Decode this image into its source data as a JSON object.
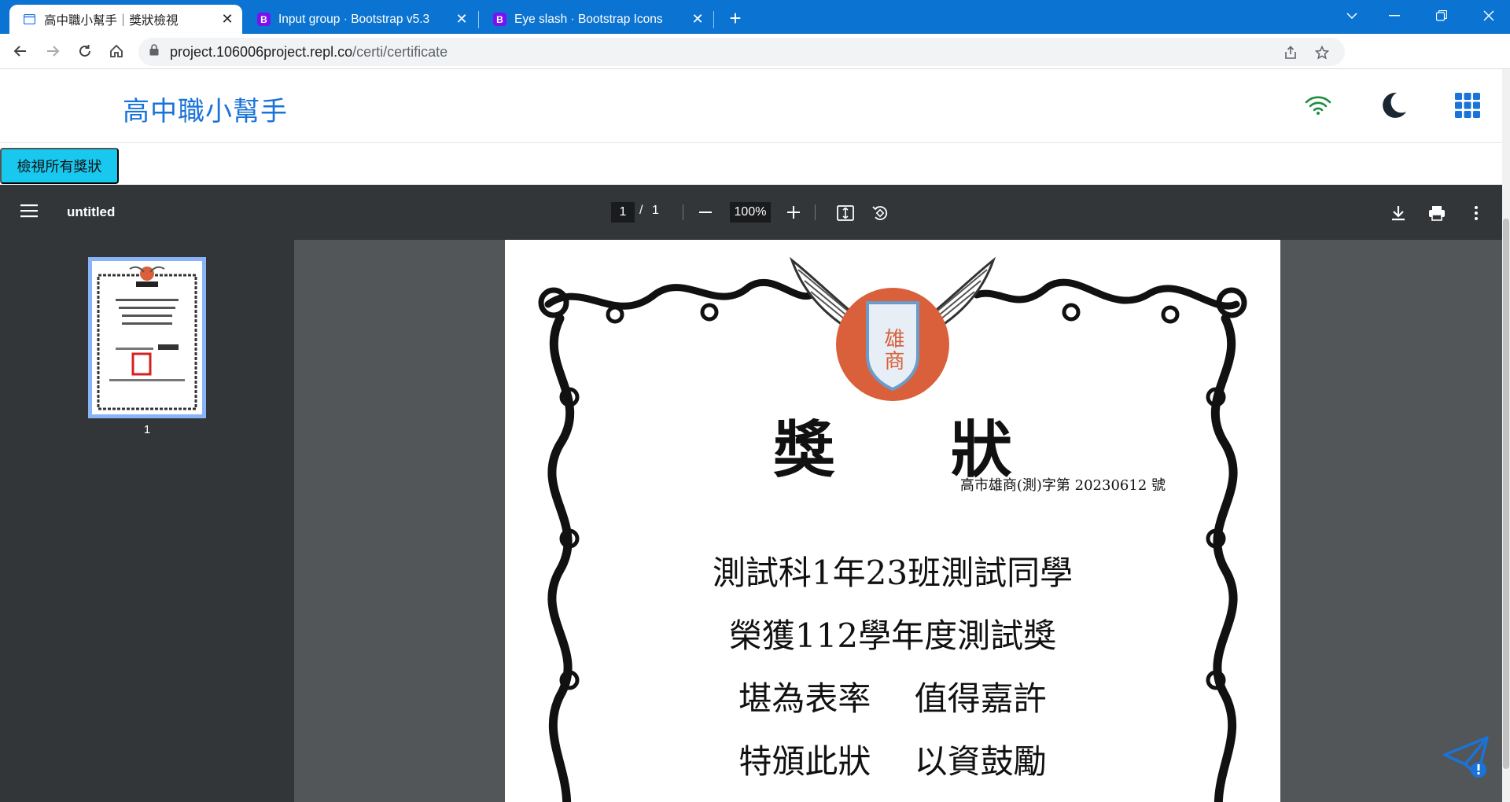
{
  "browser": {
    "tabs": [
      {
        "title": "高中職小幫手｜獎狀檢視",
        "active": true
      },
      {
        "title": "Input group · Bootstrap v5.3",
        "active": false
      },
      {
        "title": "Eye slash · Bootstrap Icons",
        "active": false
      }
    ],
    "url_host": "project.106006project.repl.co",
    "url_path": "/certi/certificate"
  },
  "site": {
    "brand": "高中職小幫手",
    "view_all_button": "檢視所有獎狀",
    "colors": {
      "brand": "#1a73d8",
      "button": "#18c8ef",
      "wifi": "#1e8e3e"
    }
  },
  "pdf": {
    "title": "untitled",
    "current_page": "1",
    "page_separator": "/",
    "total_pages": "1",
    "zoom": "100%",
    "thumbnail_label": "1"
  },
  "certificate": {
    "school_emblem_text": "雄商",
    "title": "獎 狀",
    "number": "高市雄商(測)字第 20230612 號",
    "lines": [
      "測試科1年23班測試同學",
      "榮獲112學年度測試獎",
      "堪為表率　 值得嘉許",
      "特頒此狀　 以資鼓勵"
    ]
  }
}
